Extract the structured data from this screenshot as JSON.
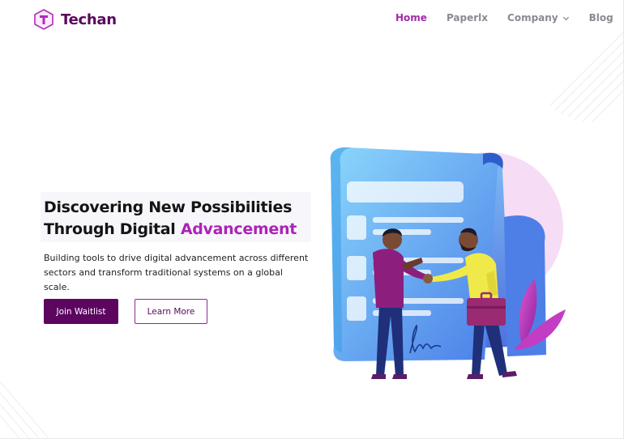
{
  "brand": {
    "name": "Techan",
    "mark_letter": "T",
    "colors": {
      "primary": "#5c0660",
      "accent": "#ad22b8",
      "nav_active": "#a12ca8",
      "nav_text": "#8a8a92"
    }
  },
  "nav": {
    "items": [
      {
        "label": "Home",
        "active": true
      },
      {
        "label": "Paperlx",
        "active": false
      },
      {
        "label": "Company",
        "active": false,
        "has_dropdown": true,
        "icon": "chevron-down-icon"
      },
      {
        "label": "Blog",
        "active": false
      }
    ]
  },
  "hero": {
    "headline_line1": "Discovering New Possibilities",
    "headline_line2_prefix": "Through Digital ",
    "headline_line2_accent": "Advancement",
    "subtext": "Building tools to drive digital advancement across different sectors and transform traditional systems on a global scale.",
    "primary_button": "Join Waitlist",
    "secondary_button": "Learn More"
  }
}
